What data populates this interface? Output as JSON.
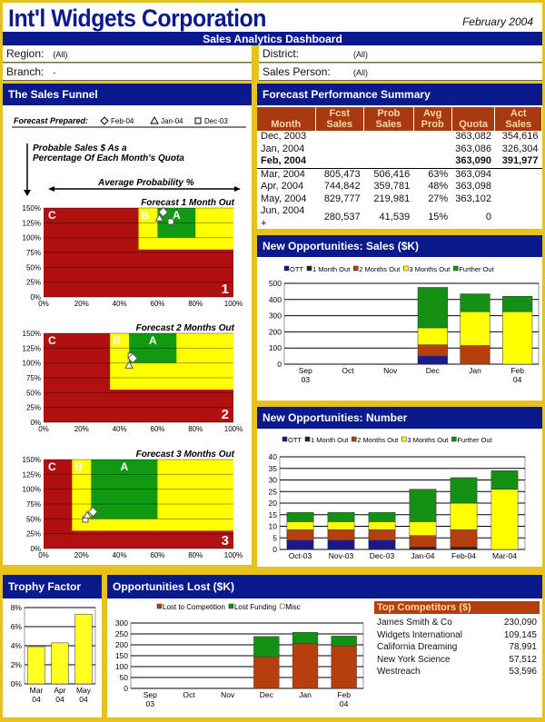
{
  "header": {
    "company": "Int'l Widgets Corporation",
    "date": "February 2004",
    "title": "Sales Analytics Dashboard"
  },
  "filters": [
    {
      "label": "Region:",
      "value": "(All)"
    },
    {
      "label": "Branch:",
      "value": "-"
    },
    {
      "label": "District:",
      "value": "(All)"
    },
    {
      "label": "Sales Person:",
      "value": "(All)"
    }
  ],
  "funnel": {
    "title": "The Sales Funnel",
    "prepared_label": "Forecast Prepared:",
    "legend": [
      {
        "symbol": "diamond",
        "label": "Feb-04"
      },
      {
        "symbol": "triangle",
        "label": "Jan-04"
      },
      {
        "symbol": "square",
        "label": "Dec-03"
      }
    ],
    "y_note": "Probable Sales $ As a Percentage Of Each Month's Quota",
    "x_note": "Average Probability %",
    "colors": {
      "C": "#b01010",
      "B": "#ffff00",
      "A": "#119911"
    },
    "x_ticks": [
      "0%",
      "20%",
      "40%",
      "60%",
      "80%",
      "100%"
    ],
    "y_ticks": [
      "0%",
      "25%",
      "50%",
      "75%",
      "100%",
      "125%",
      "150%"
    ],
    "charts": [
      {
        "title": "Forecast 1 Month Out",
        "number": "1",
        "B": {
          "x": [
            50,
            100
          ],
          "ymin": 80
        },
        "A": {
          "x": [
            60,
            80
          ],
          "ymin": 100
        },
        "points": {
          "diamond": [
            63,
            143
          ],
          "triangle": [
            61,
            133
          ],
          "square": [
            67,
            127
          ]
        }
      },
      {
        "title": "Forecast 2 Months Out",
        "number": "2",
        "B": {
          "x": [
            35,
            100
          ],
          "ymin": 55
        },
        "A": {
          "x": [
            45,
            70
          ],
          "ymin": 100
        },
        "points": {
          "diamond": [
            47,
            108
          ],
          "triangle": [
            45,
            96
          ],
          "square": [
            46,
            112
          ]
        }
      },
      {
        "title": "Forecast 3 Months Out",
        "number": "3",
        "B": {
          "x": [
            15,
            100
          ],
          "ymin": 30
        },
        "A": {
          "x": [
            25,
            60
          ],
          "ymin": 50
        },
        "points": {
          "diamond": [
            26,
            62
          ],
          "triangle": [
            23,
            56
          ],
          "square": [
            22,
            49
          ]
        }
      }
    ]
  },
  "forecast": {
    "title": "Forecast Performance Summary",
    "columns": [
      "Month",
      "Fcst Sales",
      "Prob Sales",
      "Avg Prob",
      "Quota",
      "Act Sales"
    ],
    "rows": [
      [
        "Dec, 2003",
        "",
        "",
        "",
        "363,082",
        "354,616"
      ],
      [
        "Jan, 2004",
        "",
        "",
        "",
        "363,086",
        "326,304"
      ],
      [
        "Feb, 2004",
        "",
        "",
        "",
        "363,090",
        "391,977"
      ],
      [
        "Mar, 2004",
        "805,473",
        "506,416",
        "63%",
        "363,094",
        ""
      ],
      [
        "Apr, 2004",
        "744,842",
        "359,781",
        "48%",
        "363,098",
        ""
      ],
      [
        "May, 2004",
        "829,777",
        "219,981",
        "27%",
        "363,102",
        ""
      ],
      [
        "Jun, 2004 +",
        "280,537",
        "41,539",
        "15%",
        "0",
        ""
      ]
    ]
  },
  "chart_data": [
    {
      "type": "bar",
      "stacked": true,
      "title": "New Opportunities:  Sales ($K)",
      "categories": [
        "Sep 03",
        "Oct",
        "Nov",
        "Dec",
        "Jan",
        "Feb 04"
      ],
      "ylim": [
        0,
        500
      ],
      "yticks": [
        0,
        100,
        200,
        300,
        400,
        500
      ],
      "legend": "top",
      "series": [
        {
          "name": "OTT",
          "color": "#1a1a8c",
          "values": [
            0,
            0,
            0,
            50,
            0,
            0
          ]
        },
        {
          "name": "1 Month Out",
          "color": "#222222",
          "values": [
            0,
            0,
            0,
            0,
            0,
            0
          ]
        },
        {
          "name": "2 Months Out",
          "color": "#b5400e",
          "values": [
            0,
            0,
            0,
            70,
            115,
            0
          ]
        },
        {
          "name": "3 Months Out",
          "color": "#ffff00",
          "values": [
            0,
            0,
            0,
            105,
            210,
            325
          ]
        },
        {
          "name": "Further Out",
          "color": "#149014",
          "values": [
            0,
            0,
            0,
            250,
            110,
            95
          ]
        }
      ]
    },
    {
      "type": "bar",
      "stacked": true,
      "title": "New Opportunities:  Number",
      "categories": [
        "Oct-03",
        "Nov-03",
        "Dec-03",
        "Jan-04",
        "Feb-04",
        "Mar-04"
      ],
      "ylim": [
        0,
        40
      ],
      "yticks": [
        0,
        5,
        10,
        15,
        20,
        25,
        30,
        35,
        40
      ],
      "legend": "top",
      "series": [
        {
          "name": "OTT",
          "color": "#1a1a8c",
          "values": [
            4,
            4,
            4,
            0,
            0,
            0
          ]
        },
        {
          "name": "1 Month Out",
          "color": "#222222",
          "values": [
            0,
            0,
            0,
            1,
            1,
            0
          ]
        },
        {
          "name": "2 Months Out",
          "color": "#b5400e",
          "values": [
            4.5,
            4.5,
            4.5,
            5,
            7.5,
            0
          ]
        },
        {
          "name": "3 Months Out",
          "color": "#ffff00",
          "values": [
            3.5,
            3.5,
            3.5,
            6,
            11.5,
            26
          ]
        },
        {
          "name": "Further Out",
          "color": "#149014",
          "values": [
            4,
            4,
            4,
            14,
            11,
            8
          ]
        }
      ]
    },
    {
      "type": "bar",
      "title": "Trophy Factor",
      "categories": [
        "Mar 04",
        "Apr 04",
        "May 04"
      ],
      "ylim": [
        0,
        8
      ],
      "yticks": [
        0,
        2,
        4,
        6,
        8
      ],
      "ysuffix": "%",
      "legend": "none",
      "series": [
        {
          "color": "#ffff22",
          "values": [
            3.9,
            4.3,
            7.3
          ]
        }
      ]
    },
    {
      "type": "bar",
      "stacked": true,
      "title": "Opportunities Lost ($K)",
      "categories": [
        "Sep 03",
        "Oct",
        "Nov",
        "Dec",
        "Jan",
        "Feb 04"
      ],
      "ylim": [
        0,
        300
      ],
      "yticks": [
        0,
        50,
        100,
        150,
        200,
        250,
        300
      ],
      "legend": "top",
      "series": [
        {
          "name": "Lost to Competition",
          "color": "#b5400e",
          "values": [
            0,
            0,
            0,
            145,
            205,
            195
          ]
        },
        {
          "name": "Lost Funding",
          "color": "#149014",
          "values": [
            0,
            0,
            0,
            93,
            52,
            45
          ]
        },
        {
          "name": "Misc",
          "color": "#ffffcc",
          "values": [
            0,
            0,
            0,
            0,
            0,
            0
          ]
        }
      ]
    }
  ],
  "competitors": {
    "title": "Top Competitors ($)",
    "rows": [
      [
        "James Smith & Co",
        "230,090"
      ],
      [
        "Widgets International",
        "109,145"
      ],
      [
        "California Dreaming",
        "78,991"
      ],
      [
        "New York Science",
        "57,512"
      ],
      [
        "Westreach",
        "53,596"
      ]
    ]
  }
}
